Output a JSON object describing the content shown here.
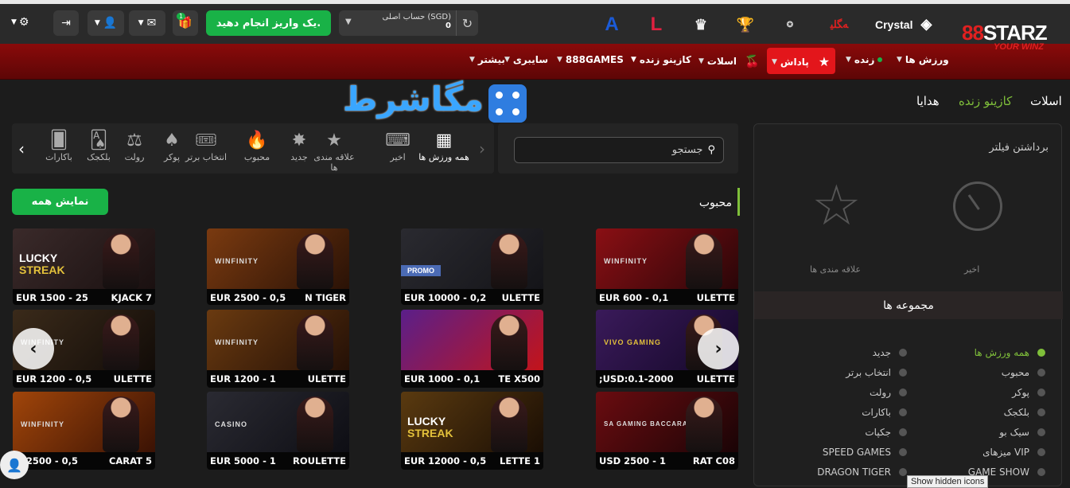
{
  "header": {
    "brand_top": "8",
    "brand_mid": "8",
    "brand_name": "STARZ",
    "brand_tagline": "YOUR WINZ",
    "crystal": "Crystal",
    "deposit_label": "یک واریز انجام دهید.",
    "balance_label": "حساب اصلی (SGD)",
    "balance_value": "0",
    "gift_badge": "1"
  },
  "nav": {
    "sports": "ورزش ها",
    "live": "زنده",
    "bonus": "پاداش",
    "slots": "اسلات",
    "live_casino": "کازینو زنده",
    "games888": "888GAMES",
    "cyber": "سایبری",
    "more": "بیشتر"
  },
  "tabs": {
    "slots": "اسلات",
    "live_casino": "کازینو زنده",
    "gifts": "هدایا"
  },
  "watermark_text": "مگاشرط",
  "categories": [
    {
      "label": "همه ورزش ها",
      "icon": "grid-icon"
    },
    {
      "label": "اخیر",
      "icon": "recent-icon"
    },
    {
      "label": "علاقه مندی ها",
      "icon": "star-icon"
    },
    {
      "label": "جدید",
      "icon": "new-icon"
    },
    {
      "label": "محبوب",
      "icon": "fire-icon"
    },
    {
      "label": "انتخاب برتر",
      "icon": "ticket-icon"
    },
    {
      "label": "پوکر",
      "icon": "poker-icon"
    },
    {
      "label": "رولت",
      "icon": "roulette-icon"
    },
    {
      "label": "بلکجک",
      "icon": "blackjack-icon"
    },
    {
      "label": "باکارات",
      "icon": "baccarat-icon"
    }
  ],
  "search_placeholder": "جستجو",
  "section_title": "محبوب",
  "show_all": "نمایش همه",
  "cards": [
    {
      "left": "EUR 1500 - 25",
      "right": "KJACK 7"
    },
    {
      "left": "EUR 2500 - 0,5",
      "right": "N TIGER"
    },
    {
      "left": "EUR 10000 - 0,2",
      "right": "ULETTE"
    },
    {
      "left": "EUR 600 - 0,1",
      "right": "ULETTE"
    },
    {
      "left": "EUR 1200 - 0,5",
      "right": "ULETTE"
    },
    {
      "left": "EUR 1200 - 1",
      "right": "ULETTE"
    },
    {
      "left": "EUR 1000 - 0,1",
      "right": "TE X500"
    },
    {
      "left": ";USD:0.1-2000",
      "right": "ULETTE"
    },
    {
      "left": "R 2500 - 0,5",
      "right": "CARAT 5"
    },
    {
      "left": "EUR 5000 - 1",
      "right": "ROULETTE"
    },
    {
      "left": "EUR 12000 - 0,5",
      "right": "LETTE 1"
    },
    {
      "left": "USD 2500 - 1",
      "right": "RAT C08"
    }
  ],
  "card_labels": {
    "lucky1": "LUCKY",
    "lucky2": "STREAK",
    "winfinity": "WINFINITY",
    "promo": "PROMO",
    "vivo": "VIVO GAMING",
    "wcasino": "CASINO",
    "sa": "SA GAMING BACCARAT"
  },
  "filter": {
    "remove": "برداشتن فیلتر",
    "recent": "اخیر",
    "favorites": "علاقه مندی ها",
    "collections": "مجموعه ها",
    "right_col": [
      "همه ورزش ها",
      "محبوب",
      "پوکر",
      "بلکجک",
      "سیک بو",
      "میزهای VIP",
      "GAME SHOW"
    ],
    "left_col": [
      "جدید",
      "انتخاب برتر",
      "رولت",
      "باکارات",
      "جکپات",
      "SPEED GAMES",
      "DRAGON TIGER"
    ]
  },
  "tooltip": "Show hidden icons",
  "colors": {
    "accent_green": "#19b247",
    "brand_red": "#e02020",
    "active_green": "#7fbf3a"
  }
}
